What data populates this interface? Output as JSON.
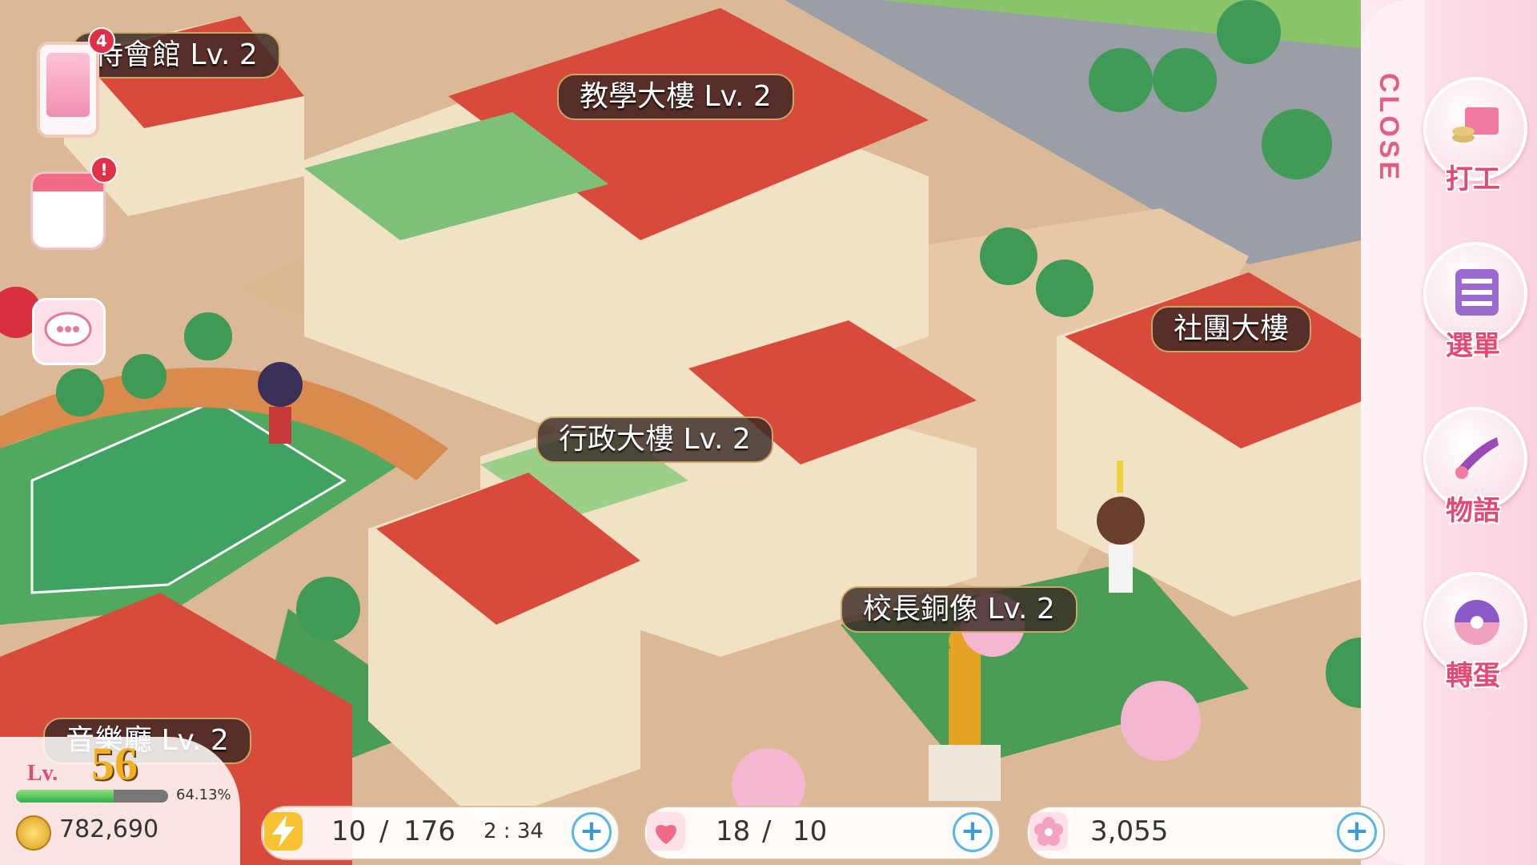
{
  "buildings": {
    "guest_hall": "待會館 Lv. 2",
    "teaching": "教學大樓 Lv. 2",
    "club": "社團大樓",
    "admin": "行政大樓 Lv. 2",
    "statue": "校長銅像 Lv. 2",
    "music": "音樂廳 Lv. 2"
  },
  "left_icons": {
    "phone_badge": "4",
    "calendar_badge": "!"
  },
  "side_menu": {
    "close": "CLOSE",
    "items": [
      {
        "label": "打工",
        "icon": "coins-book-icon"
      },
      {
        "label": "選單",
        "icon": "menu-list-icon"
      },
      {
        "label": "物語",
        "icon": "story-book-icon"
      },
      {
        "label": "轉蛋",
        "icon": "gacha-ball-icon"
      }
    ]
  },
  "player": {
    "level_prefix": "Lv.",
    "level": "56",
    "xp_percent": "64.13%",
    "xp_fraction": 0.6413,
    "coins": "782,690"
  },
  "resources": {
    "energy": {
      "current": "10",
      "max": "176",
      "sep": "/",
      "timer": "2 : 34"
    },
    "hearts": {
      "current": "18",
      "max": "10",
      "sep": "/"
    },
    "flowers": {
      "value": "3,055"
    }
  },
  "colors": {
    "accent_pink": "#e24a73",
    "roof_red": "#d84a3a",
    "grass": "#3f9a56",
    "path": "#e2c29e"
  }
}
